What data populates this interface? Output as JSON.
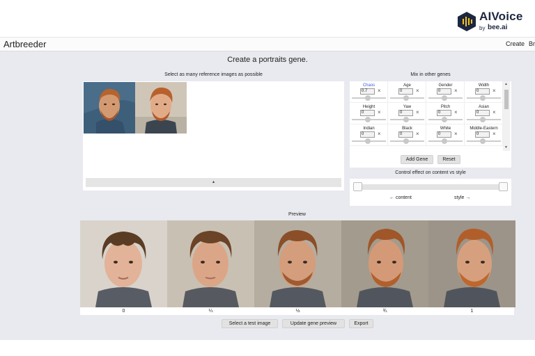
{
  "logo": {
    "name": "AIVoice",
    "by": "by",
    "bee": "bee.ai"
  },
  "app": {
    "title": "Artbreeder"
  },
  "nav": {
    "items": [
      "Create",
      "Br"
    ]
  },
  "page": {
    "title": "Create a portraits gene."
  },
  "references": {
    "label": "Select as many reference images as possible",
    "collapse_glyph": "▴",
    "images": [
      "portrait-painting-redhead",
      "portrait-painting-redhead-2"
    ]
  },
  "genes": {
    "label": "Mix in other genes",
    "items": [
      {
        "name": "Chaos",
        "value": "0.7",
        "active": true
      },
      {
        "name": "Age",
        "value": "0"
      },
      {
        "name": "Gender",
        "value": "0"
      },
      {
        "name": "Width",
        "value": "0"
      },
      {
        "name": "Height",
        "value": "0"
      },
      {
        "name": "Yaw",
        "value": "0"
      },
      {
        "name": "Pitch",
        "value": "0"
      },
      {
        "name": "Asian",
        "value": "0"
      },
      {
        "name": "Indian",
        "value": "0"
      },
      {
        "name": "Black",
        "value": "0"
      },
      {
        "name": "White",
        "value": "0"
      },
      {
        "name": "Middle-Eastern",
        "value": "0"
      }
    ],
    "remove_glyph": "×",
    "add_label": "Add Gene",
    "reset_label": "Reset"
  },
  "control": {
    "label": "Control effect on content vs style",
    "content_label": "← content",
    "style_label": "style →"
  },
  "preview": {
    "label": "Preview",
    "steps": [
      "0",
      "¼",
      "½",
      "¾",
      "1"
    ]
  },
  "actions": {
    "test_image": "Select a test image",
    "update": "Update gene preview",
    "export": "Export"
  },
  "colors": {
    "accent": "#3b5ad6",
    "logo": "#1d2740",
    "logo_yellow": "#f5c518",
    "page_bg": "#e9eaef"
  }
}
